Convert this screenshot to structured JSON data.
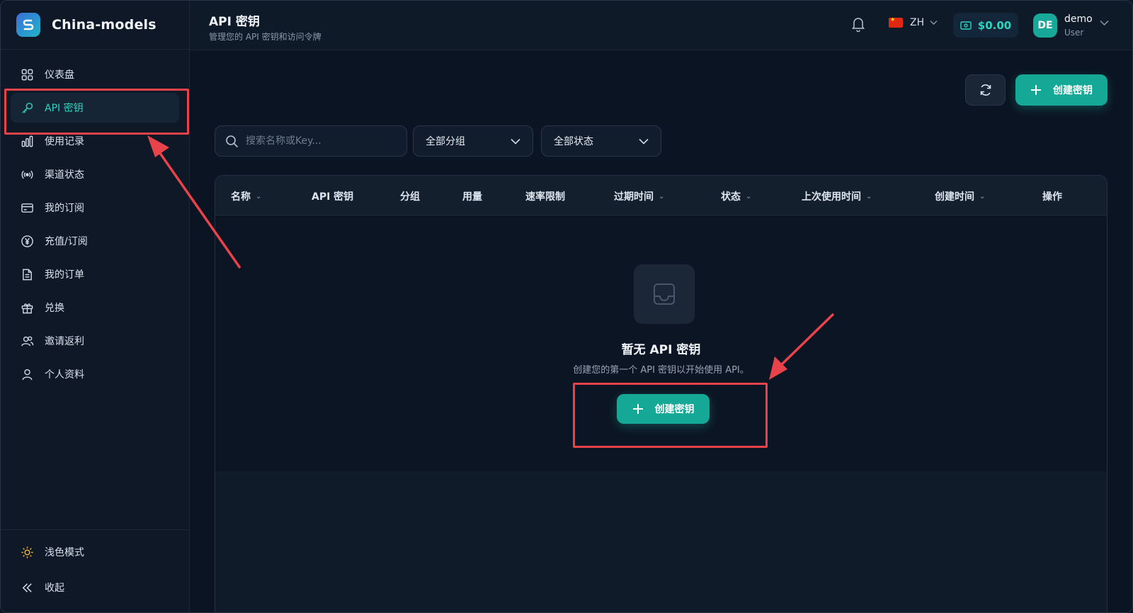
{
  "brand": {
    "name": "China-models"
  },
  "sidebar": {
    "items": [
      {
        "label": "仪表盘",
        "icon": "grid-icon"
      },
      {
        "label": "API 密钥",
        "icon": "key-icon",
        "active": true
      },
      {
        "label": "使用记录",
        "icon": "bar-chart-icon"
      },
      {
        "label": "渠道状态",
        "icon": "signal-icon"
      },
      {
        "label": "我的订阅",
        "icon": "card-icon"
      },
      {
        "label": "充值/订阅",
        "icon": "yen-icon"
      },
      {
        "label": "我的订单",
        "icon": "document-icon"
      },
      {
        "label": "兑换",
        "icon": "gift-icon"
      },
      {
        "label": "邀请返利",
        "icon": "users-icon"
      },
      {
        "label": "个人资料",
        "icon": "user-icon"
      }
    ],
    "bottom": {
      "theme_label": "浅色模式",
      "collapse_label": "收起"
    }
  },
  "header": {
    "title": "API 密钥",
    "subtitle": "管理您的 API 密钥和访问令牌",
    "language": "ZH",
    "balance": "$0.00",
    "user": {
      "initials": "DE",
      "name": "demo",
      "role": "User"
    }
  },
  "toolbar": {
    "create_label": "创建密钥",
    "search_placeholder": "搜索名称或Key...",
    "group_filter": "全部分组",
    "status_filter": "全部状态"
  },
  "table": {
    "columns": [
      "名称",
      "API 密钥",
      "分组",
      "用量",
      "速率限制",
      "过期时间",
      "状态",
      "上次使用时间",
      "创建时间",
      "操作"
    ]
  },
  "empty_state": {
    "title": "暂无 API 密钥",
    "subtitle": "创建您的第一个 API 密钥以开始使用 API。",
    "create_label": "创建密钥"
  },
  "colors": {
    "accent": "#16a896",
    "active_text": "#2dd4bf",
    "annotation": "#e8424a"
  }
}
